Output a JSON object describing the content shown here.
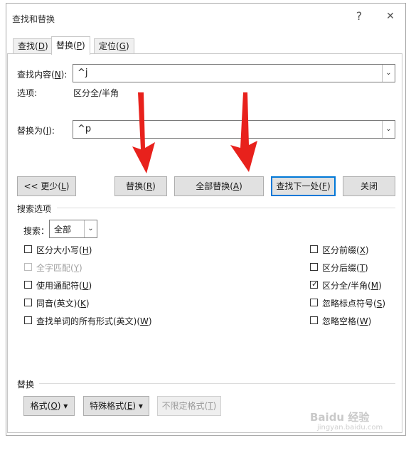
{
  "window": {
    "title": "查找和替换",
    "help_glyph": "?",
    "close_glyph": "✕"
  },
  "tabs": [
    {
      "label": "查找(",
      "key": "D",
      "end": ")"
    },
    {
      "label": "替换(",
      "key": "P",
      "end": ")"
    },
    {
      "label": "定位(",
      "key": "G",
      "end": ")"
    }
  ],
  "find": {
    "label": "查找内容(",
    "key": "N",
    "end": "):",
    "value": "^j"
  },
  "options_summary": {
    "label": "选项:",
    "value": "区分全/半角"
  },
  "replace": {
    "label": "替换为(",
    "key": "I",
    "end": "):",
    "value": "^p"
  },
  "buttons": {
    "less": {
      "label": "<< 更少(",
      "key": "L",
      "end": ")"
    },
    "replace": {
      "label": "替换(",
      "key": "R",
      "end": ")"
    },
    "replace_all": {
      "label": "全部替换(",
      "key": "A",
      "end": ")"
    },
    "find_next": {
      "label": "查找下一处(",
      "key": "F",
      "end": ")"
    },
    "close": {
      "label": "关闭"
    }
  },
  "search_options": {
    "header": "搜索选项",
    "search_label": "搜索",
    "search_key": "：",
    "search_value": "全部"
  },
  "left_options": [
    {
      "label": "区分大小写(",
      "key": "H",
      "end": ")",
      "checked": false,
      "disabled": false
    },
    {
      "label": "全字匹配(",
      "key": "Y",
      "end": ")",
      "checked": false,
      "disabled": true
    },
    {
      "label": "使用通配符(",
      "key": "U",
      "end": ")",
      "checked": false,
      "disabled": false
    },
    {
      "label": "同音(英文)(",
      "key": "K",
      "end": ")",
      "checked": false,
      "disabled": false
    },
    {
      "label": "查找单词的所有形式(英文)(",
      "key": "W",
      "end": ")",
      "checked": false,
      "disabled": false
    }
  ],
  "right_options": [
    {
      "label": "区分前缀(",
      "key": "X",
      "end": ")",
      "checked": false
    },
    {
      "label": "区分后缀(",
      "key": "T",
      "end": ")",
      "checked": false
    },
    {
      "label": "区分全/半角(",
      "key": "M",
      "end": ")",
      "checked": true
    },
    {
      "label": "忽略标点符号(",
      "key": "S",
      "end": ")",
      "checked": false
    },
    {
      "label": "忽略空格(",
      "key": "W",
      "end": ")",
      "checked": false
    }
  ],
  "replace_section": {
    "header": "替换",
    "format": {
      "label": "格式(",
      "key": "O",
      "end": ") ▾"
    },
    "special": {
      "label": "特殊格式(",
      "key": "E",
      "end": ") ▾"
    },
    "no_format": {
      "label": "不限定格式(",
      "key": "T",
      "end": ")"
    }
  },
  "watermark": {
    "text": "Baidu 经验",
    "sub": "jingyan.baidu.com"
  },
  "colors": {
    "accent": "#0078d7",
    "arrow": "#e8211c"
  }
}
